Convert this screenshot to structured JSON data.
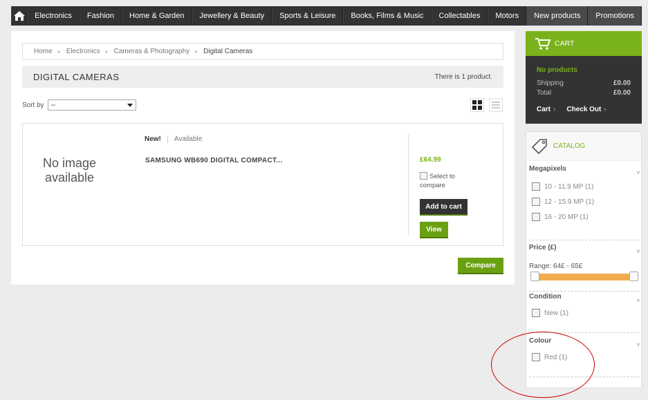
{
  "nav": {
    "items": [
      "Electronics",
      "Fashion",
      "Home & Garden",
      "Jewellery & Beauty",
      "Sports & Leisure",
      "Books, Films & Music",
      "Collectables",
      "Motors"
    ],
    "right": [
      "New products",
      "Promotions"
    ]
  },
  "breadcrumb": [
    "Home",
    "Electronics",
    "Cameras & Photography",
    "Digital Cameras"
  ],
  "category": {
    "title": "DIGITAL CAMERAS",
    "count": "There is 1 product."
  },
  "sort": {
    "label": "Sort by",
    "value": "--"
  },
  "product": {
    "no_image_1": "No image",
    "no_image_2": "available",
    "flag_new": "New!",
    "availability": "Available",
    "name": "SAMSUNG WB690 DIGITAL COMPACT...",
    "price": "£64.99",
    "compare_label": "Select to compare",
    "add_to_cart": "Add to cart",
    "view": "View"
  },
  "compare_button": "Compare",
  "cart": {
    "title": "CART",
    "empty": "No products",
    "shipping_label": "Shipping",
    "shipping_value": "£0.00",
    "total_label": "Total",
    "total_value": "£0.00",
    "cart_link": "Cart",
    "checkout_link": "Check Out"
  },
  "catalog": {
    "title": "CATALOG",
    "megapixels": {
      "title": "Megapixels",
      "options": [
        "10 - 11.9 MP (1)",
        "12 - 15.9 MP (1)",
        "16 - 20 MP (1)"
      ]
    },
    "price": {
      "title": "Price (£)",
      "range": "Range: 64£ - 65£"
    },
    "condition": {
      "title": "Condition",
      "options": [
        "New (1)"
      ]
    },
    "colour": {
      "title": "Colour",
      "options": [
        "Red (1)"
      ]
    },
    "arrow": "v"
  },
  "colors": {
    "accent": "#7ab21c",
    "nav_bg": "#333333",
    "slider": "#f2ad50",
    "annotation": "#cc0000"
  }
}
